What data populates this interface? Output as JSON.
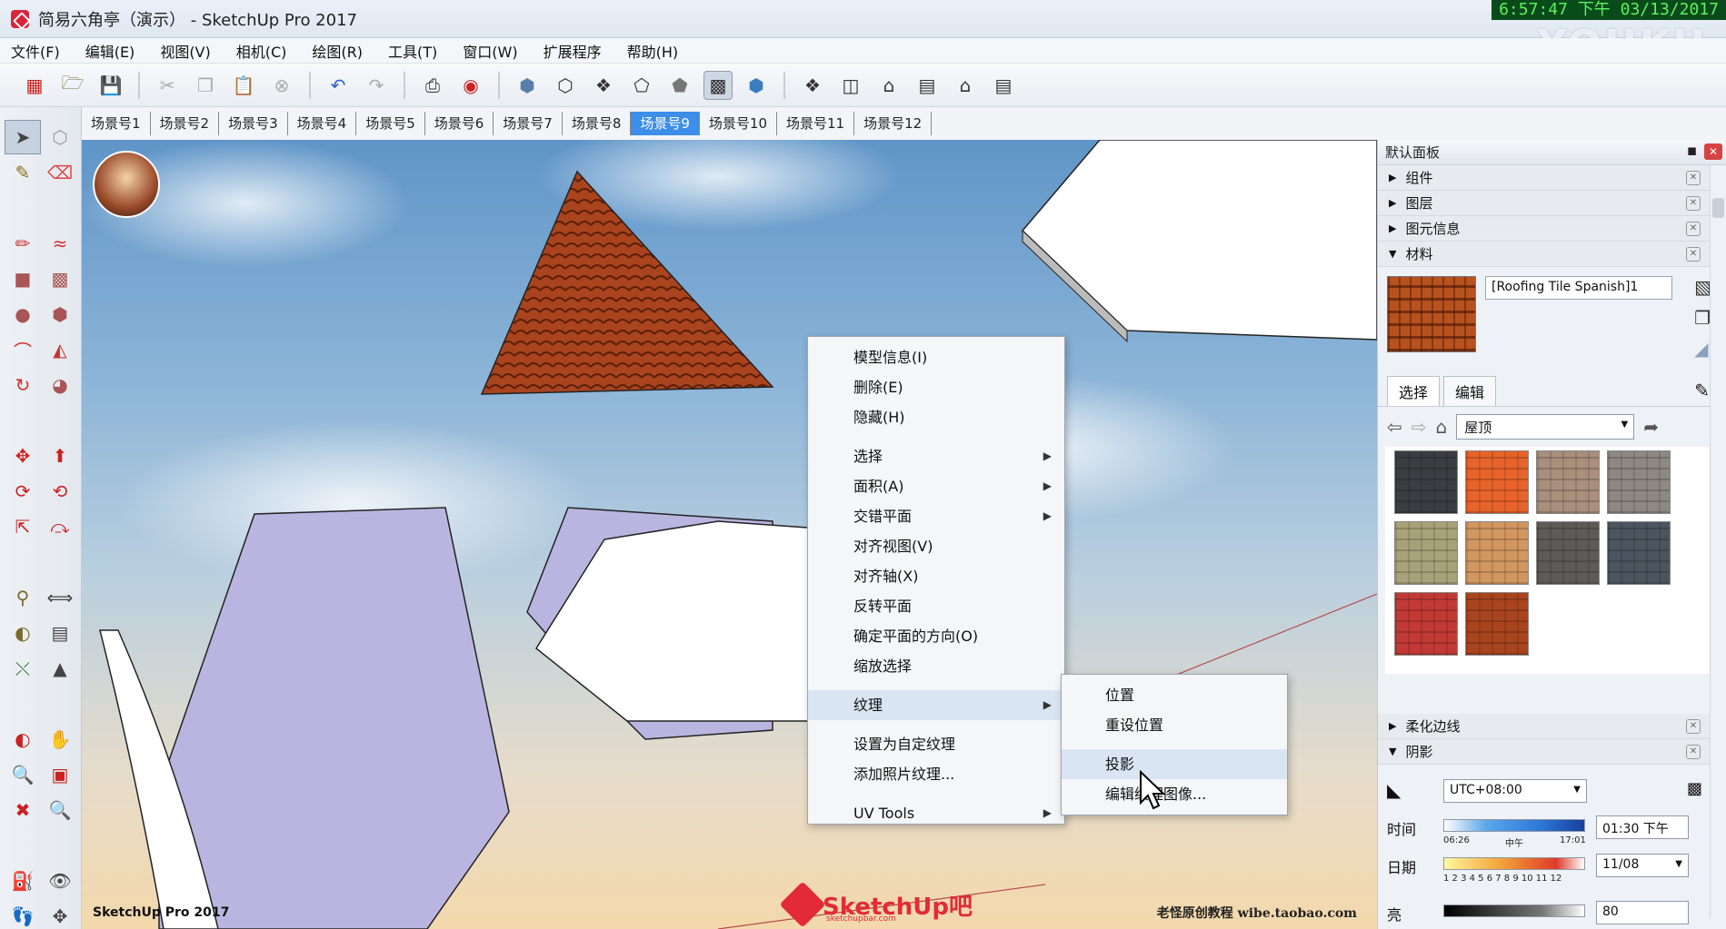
{
  "window": {
    "title": "简易六角亭（演示） - SketchUp Pro 2017",
    "clock": "6:57:47 下午 03/13/2017",
    "watermark": "YOUKU"
  },
  "menubar": [
    "文件(F)",
    "编辑(E)",
    "视图(V)",
    "相机(C)",
    "绘图(R)",
    "工具(T)",
    "窗口(W)",
    "扩展程序",
    "帮助(H)"
  ],
  "scene_tabs": {
    "items": [
      "场景号1",
      "场景号2",
      "场景号3",
      "场景号4",
      "场景号5",
      "场景号6",
      "场景号7",
      "场景号8",
      "场景号9",
      "场景号10",
      "场景号11",
      "场景号12"
    ],
    "active_index": 8
  },
  "viewport": {
    "bottom_left_label": "SketchUp Pro 2017",
    "bottom_right_credit": "老怪原创教程  wibe.taobao.com",
    "logo_text": "SketchUp吧",
    "logo_sub": "sketchupbar.com"
  },
  "context_menu": {
    "items": [
      {
        "label": "模型信息(I)"
      },
      {
        "label": "删除(E)"
      },
      {
        "label": "隐藏(H)"
      },
      {
        "label": "选择",
        "submenu": true
      },
      {
        "label": "面积(A)",
        "submenu": true
      },
      {
        "label": "交错平面",
        "submenu": true
      },
      {
        "label": "对齐视图(V)"
      },
      {
        "label": "对齐轴(X)"
      },
      {
        "label": "反转平面"
      },
      {
        "label": "确定平面的方向(O)"
      },
      {
        "label": "缩放选择"
      },
      {
        "label": "纹理",
        "submenu": true
      },
      {
        "label": "设置为自定纹理"
      },
      {
        "label": "添加照片纹理..."
      },
      {
        "label": "UV Tools",
        "submenu": true
      }
    ],
    "highlighted": "纹理"
  },
  "texture_submenu": {
    "items": [
      "位置",
      "重设位置",
      "投影",
      "编辑纹理图像..."
    ],
    "highlighted": "投影"
  },
  "right_panel": {
    "title": "默认面板",
    "trays": [
      "组件",
      "图层",
      "图元信息",
      "材料"
    ],
    "material": {
      "name": "[Roofing Tile Spanish]1",
      "tabs": [
        "选择",
        "编辑"
      ],
      "active_tab": "选择",
      "collection": "屋顶",
      "swatch_colors": [
        "#3b3d42",
        "#e7632a",
        "#a98f7c",
        "#8e8884",
        "#a8a27a",
        "#d29661",
        "#5d5b58",
        "#4b555f",
        "#c23a35",
        "#a8441e"
      ]
    },
    "lower_trays": [
      "柔化边线",
      "阴影"
    ],
    "shadow": {
      "utc": "UTC+08:00",
      "time_label": "时间",
      "date_label": "日期",
      "light_label": "亮",
      "time_start": "06:26",
      "time_noon": "中午",
      "time_end": "17:01",
      "time_value": "01:30 下午",
      "date_ticks": "1 2 3 4 5 6 7 8 9 10 11 12",
      "date_value": "11/08",
      "light_value": "80"
    }
  }
}
